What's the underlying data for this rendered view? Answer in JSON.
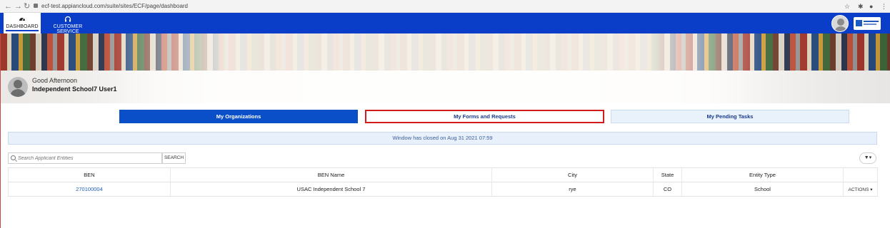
{
  "browser": {
    "url": "ecf-test.appiancloud.com/suite/sites/ECF/page/dashboard"
  },
  "header": {
    "tabs": [
      {
        "label": "DASHBOARD",
        "icon": "gauge-icon",
        "active": true
      },
      {
        "label": "CUSTOMER SERVICE",
        "icon": "headset-icon",
        "active": false
      }
    ]
  },
  "greeting": {
    "line1": "Good Afternoon",
    "line2": "Independent School7 User1"
  },
  "tabs": {
    "organizations": "My Organizations",
    "forms": "My Forms and Requests",
    "pending": "My Pending Tasks"
  },
  "notice": "Window has closed on Aug 31 2021  07:59",
  "search": {
    "placeholder": "Search Applicant Entities",
    "button": "SEARCH"
  },
  "table": {
    "columns": [
      "BEN",
      "BEN Name",
      "City",
      "State",
      "Entity Type",
      ""
    ],
    "rows": [
      {
        "ben": "270100004",
        "name": "USAC Independent School 7",
        "city": "rye",
        "state": "CO",
        "type": "School",
        "action": "ACTIONS ▾"
      }
    ]
  },
  "colors": {
    "primary": "#0a3ec9",
    "highlight_border": "#d21b1b",
    "notice_bg": "#e7f0fb"
  }
}
